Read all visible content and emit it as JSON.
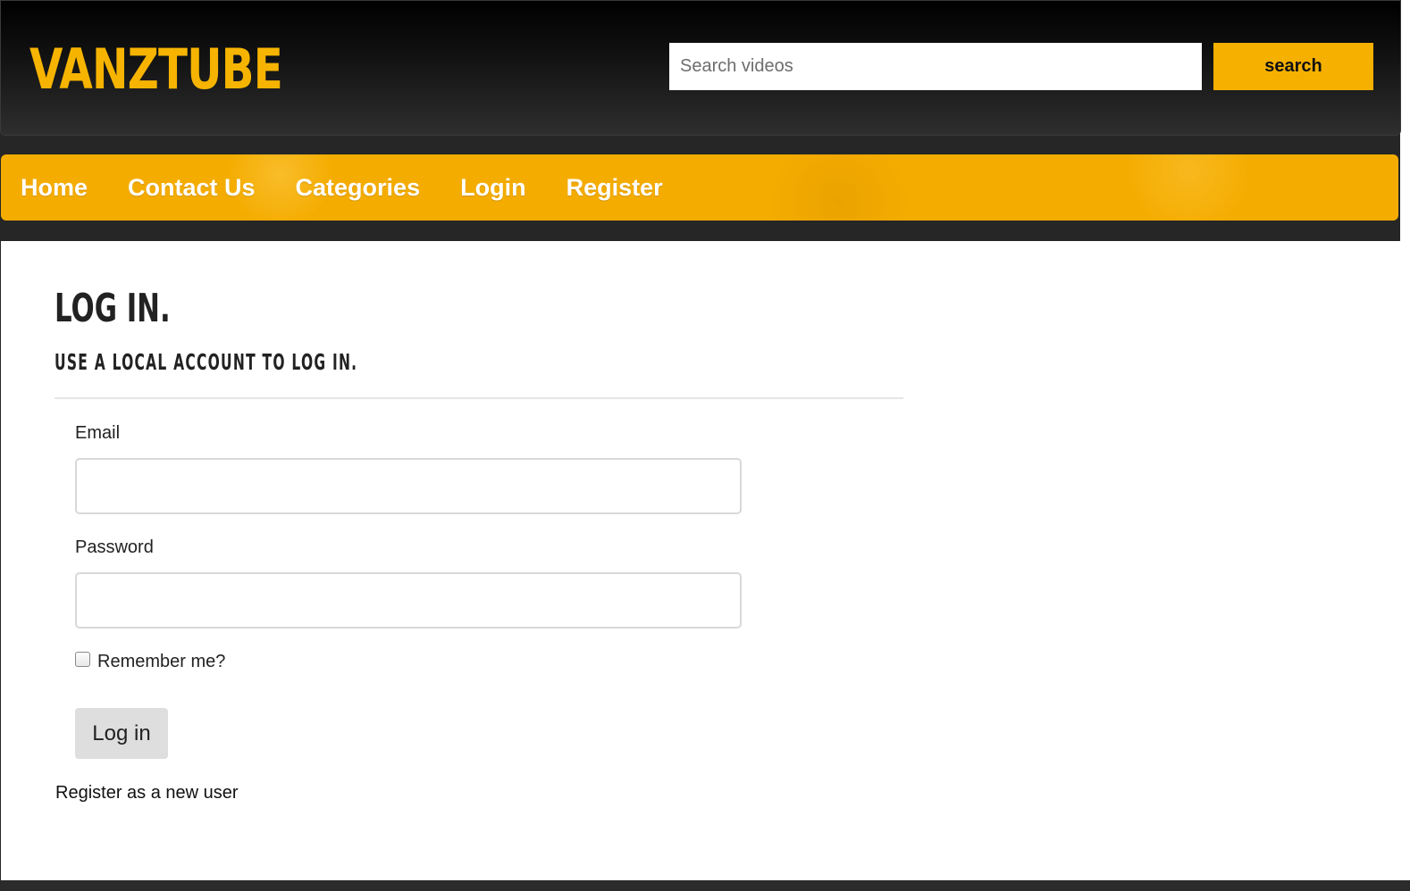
{
  "header": {
    "logo_text": "VANZTUBE",
    "search": {
      "placeholder": "Search videos",
      "value": "",
      "button_label": "search"
    }
  },
  "nav": {
    "items": [
      {
        "label": "Home"
      },
      {
        "label": "Contact Us"
      },
      {
        "label": "Categories"
      },
      {
        "label": "Login"
      },
      {
        "label": "Register"
      }
    ]
  },
  "login": {
    "title": "LOG IN.",
    "subtitle": "USE A LOCAL ACCOUNT TO LOG IN.",
    "email_label": "Email",
    "email_value": "",
    "password_label": "Password",
    "password_value": "",
    "remember_label": "Remember me?",
    "remember_checked": false,
    "submit_label": "Log in",
    "register_link": "Register as a new user"
  },
  "colors": {
    "accent": "#f5ac00",
    "header_bg": "#000000",
    "logo": "#f6b400"
  }
}
